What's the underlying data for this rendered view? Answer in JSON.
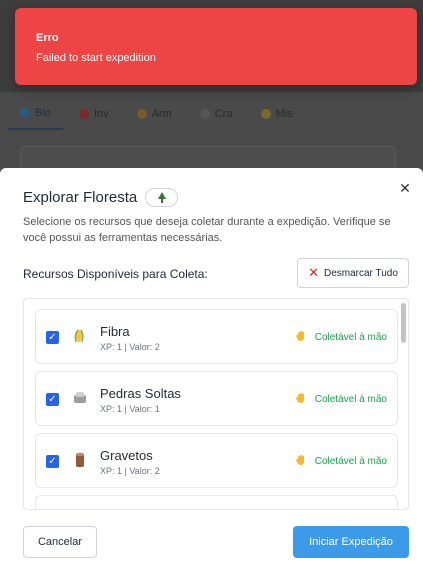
{
  "background": {
    "tabs": [
      {
        "label": "Bio",
        "icon": "globe-icon",
        "color": "#2a5a7a"
      },
      {
        "label": "Inv",
        "icon": "bag-icon",
        "color": "#7a2a2a"
      },
      {
        "label": "Arm",
        "icon": "house-icon",
        "color": "#7a5a2a"
      },
      {
        "label": "Cra",
        "icon": "hammer-icon",
        "color": "#555555"
      },
      {
        "label": "Mis",
        "icon": "star-icon",
        "color": "#7a6a2a"
      }
    ]
  },
  "toast": {
    "title": "Erro",
    "message": "Failed to start expedition",
    "color": "#ef4444"
  },
  "modal": {
    "title": "Explorar Floresta",
    "title_badge_icon": "tree-icon",
    "description": "Selecione os recursos que deseja coletar durante a expedição. Verifique se você possui as ferramentas necessárias.",
    "section_title": "Recursos Disponíveis para Coleta:",
    "deselect_label": "Desmarcar Tudo",
    "resources": [
      {
        "name": "Fibra",
        "stats": "XP: 1 | Valor: 2",
        "status": "Coletável à mão",
        "icon": "corn-icon",
        "checked": true
      },
      {
        "name": "Pedras Soltas",
        "stats": "XP: 1 | Valor: 1",
        "status": "Coletável à mão",
        "icon": "stone-icon",
        "checked": true
      },
      {
        "name": "Gravetos",
        "stats": "XP: 1 | Valor: 2",
        "status": "Coletável à mão",
        "icon": "wood-icon",
        "checked": true
      }
    ],
    "cancel_label": "Cancelar",
    "start_label": "Iniciar Expedição",
    "accent_color": "#3b9be8",
    "status_color": "#16a34a"
  }
}
